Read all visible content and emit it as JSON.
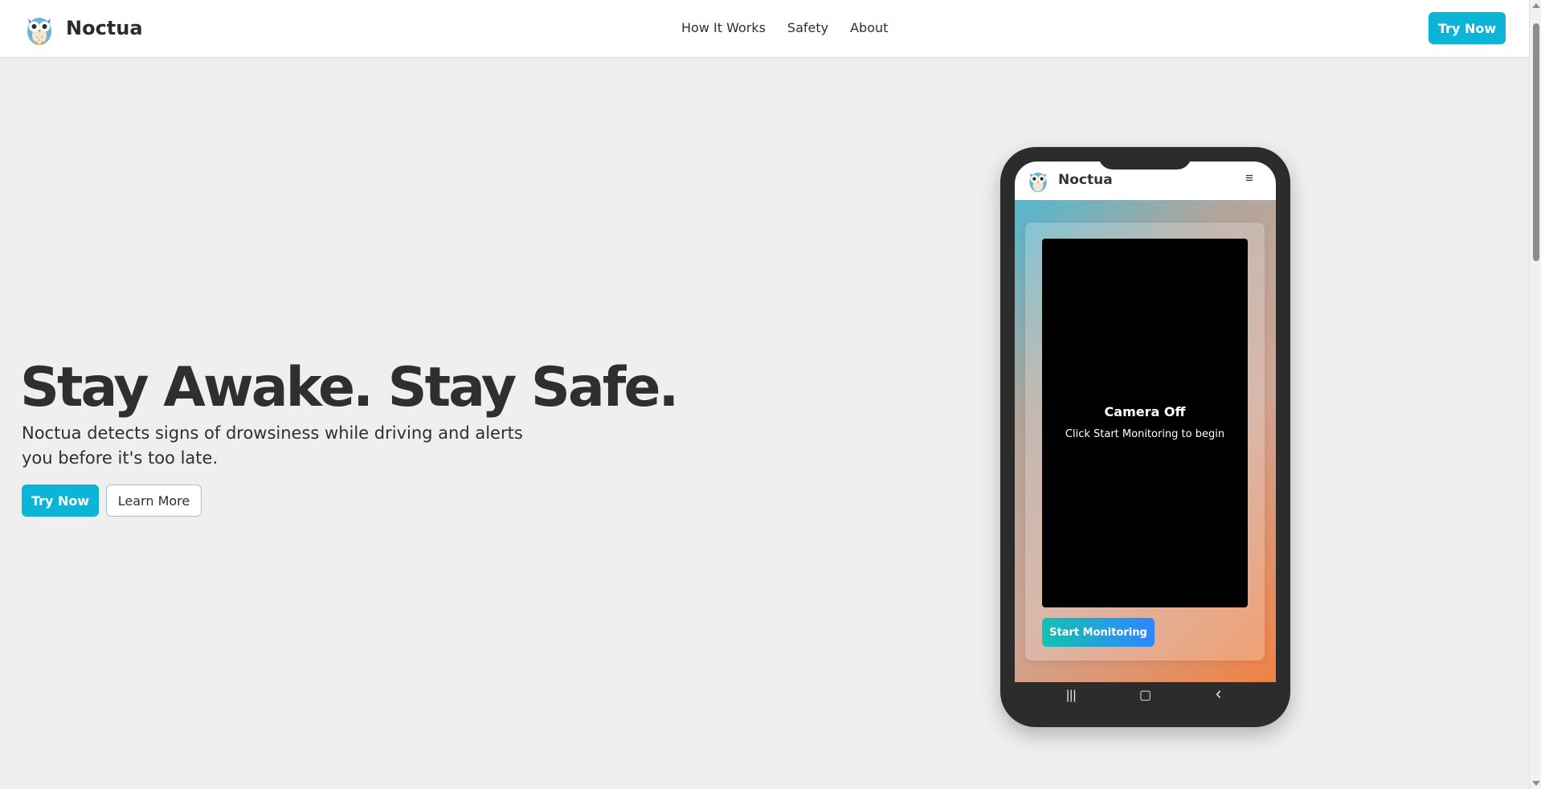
{
  "header": {
    "brand": "Noctua",
    "logo_icon": "owl-icon",
    "nav": [
      "How It Works",
      "Safety",
      "About"
    ],
    "cta_label": "Try Now"
  },
  "hero": {
    "title": "Stay Awake. Stay Safe.",
    "subtitle": "Noctua detects signs of drowsiness while driving and alerts you before it's too late.",
    "primary_label": "Try Now",
    "secondary_label": "Learn More"
  },
  "phone": {
    "brand": "Noctua",
    "menu_icon": "≡",
    "camera_title": "Camera Off",
    "camera_subtitle": "Click Start Monitoring to begin",
    "start_label": "Start Monitoring",
    "nav_keys": {
      "recents": "|||",
      "home": "▢",
      "back": "‹"
    }
  },
  "colors": {
    "accent": "#0ab5d8",
    "background": "#efefef",
    "phone_body": "#2c2c2c",
    "gradient_start": "#52b8cf",
    "gradient_end": "#f08244",
    "start_button_from": "#13c2b0",
    "start_button_to": "#2f86ff"
  }
}
